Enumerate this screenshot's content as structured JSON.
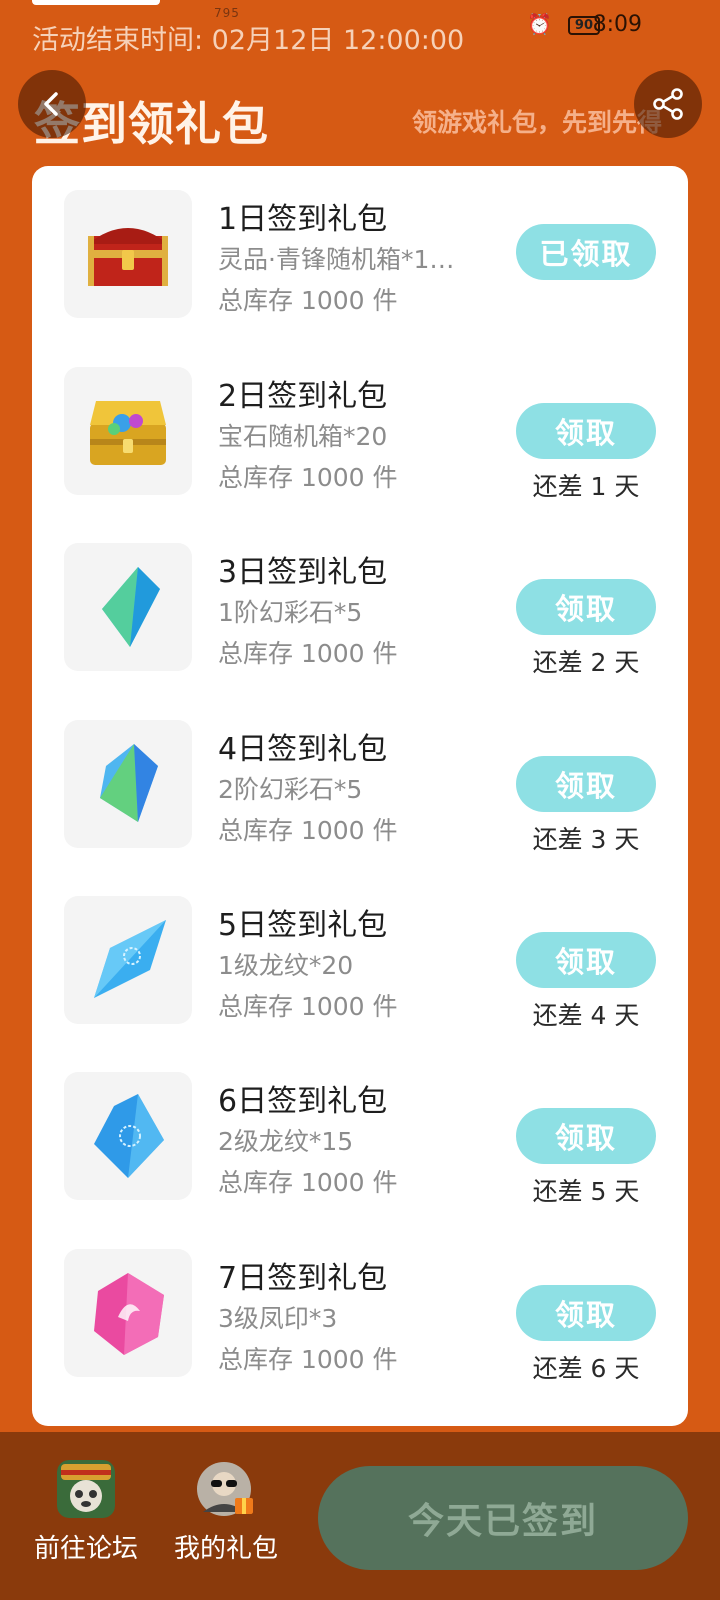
{
  "status_bar": {
    "network_speed": "795",
    "battery": "90",
    "time": "8:09"
  },
  "event": {
    "end_time_text": "活动结束时间: 02月12日 12:00:00"
  },
  "header": {
    "title": "签到领礼包",
    "slogan": "领游戏礼包，先到先得"
  },
  "gifts": [
    {
      "title": "1日签到礼包",
      "desc": "灵品·青锋随机箱*1…",
      "stock": "总库存 1000 件",
      "button": "已领取",
      "days_left": "",
      "icon": "red-chest-icon"
    },
    {
      "title": "2日签到礼包",
      "desc": "宝石随机箱*20",
      "stock": "总库存 1000 件",
      "button": "领取",
      "days_left": "还差 1 天",
      "icon": "gold-chest-icon"
    },
    {
      "title": "3日签到礼包",
      "desc": "1阶幻彩石*5",
      "stock": "总库存 1000 件",
      "button": "领取",
      "days_left": "还差 2 天",
      "icon": "crystal-icon"
    },
    {
      "title": "4日签到礼包",
      "desc": "2阶幻彩石*5",
      "stock": "总库存 1000 件",
      "button": "领取",
      "days_left": "还差 3 天",
      "icon": "crystal-icon"
    },
    {
      "title": "5日签到礼包",
      "desc": "1级龙纹*20",
      "stock": "总库存 1000 件",
      "button": "领取",
      "days_left": "还差 4 天",
      "icon": "dragon-pattern-icon"
    },
    {
      "title": "6日签到礼包",
      "desc": "2级龙纹*15",
      "stock": "总库存 1000 件",
      "button": "领取",
      "days_left": "还差 5 天",
      "icon": "dragon-pattern-icon"
    },
    {
      "title": "7日签到礼包",
      "desc": "3级凤印*3",
      "stock": "总库存 1000 件",
      "button": "领取",
      "days_left": "还差 6 天",
      "icon": "phoenix-seal-icon"
    }
  ],
  "bottom_bar": {
    "forum_label": "前往论坛",
    "my_gifts_label": "我的礼包",
    "signin_button": "今天已签到"
  },
  "colors": {
    "background": "#d65a14",
    "claim_button": "#8ee0e4",
    "bottom_bar": "#8a3a0c",
    "signed_button": "#55725c"
  }
}
